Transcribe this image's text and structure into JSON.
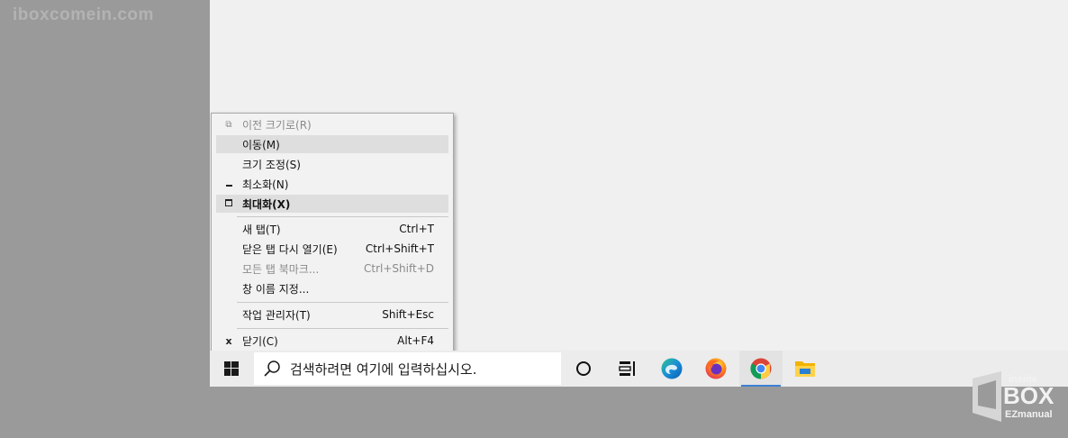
{
  "watermark": "iboxcomein.com",
  "context_menu": {
    "items": [
      {
        "label": "이전 크기로(R)",
        "shortcut": "",
        "icon": "restore-icon",
        "disabled": true
      },
      {
        "label": "이동(M)",
        "shortcut": "",
        "icon": "",
        "highlighted": true
      },
      {
        "label": "크기 조정(S)",
        "shortcut": "",
        "icon": ""
      },
      {
        "label": "최소화(N)",
        "shortcut": "",
        "icon": "minimize-icon"
      },
      {
        "label": "최대화(X)",
        "shortcut": "",
        "icon": "maximize-icon",
        "bold": true,
        "highlighted": true
      },
      {
        "label": "새 탭(T)",
        "shortcut": "Ctrl+T",
        "icon": ""
      },
      {
        "label": "닫은 탭 다시 열기(E)",
        "shortcut": "Ctrl+Shift+T",
        "icon": ""
      },
      {
        "label": "모든 탭 북마크...",
        "shortcut": "Ctrl+Shift+D",
        "icon": "",
        "disabled": true
      },
      {
        "label": "창 이름 지정...",
        "shortcut": "",
        "icon": ""
      },
      {
        "label": "작업 관리자(T)",
        "shortcut": "Shift+Esc",
        "icon": ""
      },
      {
        "label": "닫기(C)",
        "shortcut": "Alt+F4",
        "icon": "close-icon"
      }
    ]
  },
  "taskbar": {
    "search_placeholder": "검색하려면 여기에 입력하십시오.",
    "icons": [
      "windows-start-icon",
      "cortana-icon",
      "task-view-icon",
      "edge-icon",
      "firefox-icon",
      "chrome-icon",
      "file-explorer-icon"
    ],
    "accent_color": "#3c80d4"
  },
  "logo": {
    "line1": "inside",
    "line2": "BOX",
    "line3": "EZmanual"
  }
}
